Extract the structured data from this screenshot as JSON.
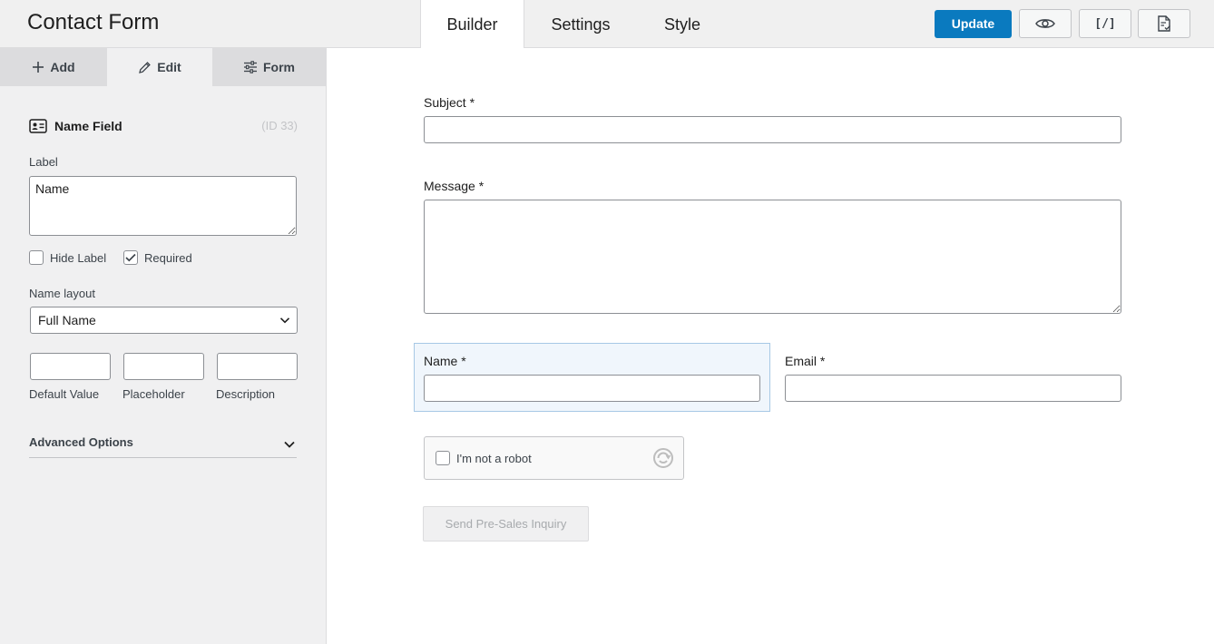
{
  "header": {
    "title": "Contact Form",
    "tabs": [
      {
        "label": "Builder",
        "active": true
      },
      {
        "label": "Settings",
        "active": false
      },
      {
        "label": "Style",
        "active": false
      }
    ],
    "update_label": "Update",
    "embed_label": "[/]",
    "accent_color": "#0a7abf"
  },
  "sidebar": {
    "tabs": [
      {
        "label": "Add",
        "icon": "plus-icon"
      },
      {
        "label": "Edit",
        "icon": "pencil-icon",
        "active": true
      },
      {
        "label": "Form",
        "icon": "sliders-icon"
      }
    ],
    "field": {
      "icon": "id-card-icon",
      "title": "Name Field",
      "id": "(ID 33)"
    },
    "label_caption": "Label",
    "label_value": "Name",
    "hide_label": {
      "label": "Hide Label",
      "checked": false
    },
    "required": {
      "label": "Required",
      "checked": true
    },
    "name_layout_caption": "Name layout",
    "name_layout_value": "Full Name",
    "sub_fields": [
      "Default Value",
      "Placeholder",
      "Description"
    ],
    "advanced_label": "Advanced Options"
  },
  "form": {
    "subject_label": "Subject *",
    "message_label": "Message *",
    "name_label": "Name *",
    "email_label": "Email *",
    "captcha_label": "I'm not a robot",
    "submit_label": "Send Pre-Sales Inquiry"
  }
}
